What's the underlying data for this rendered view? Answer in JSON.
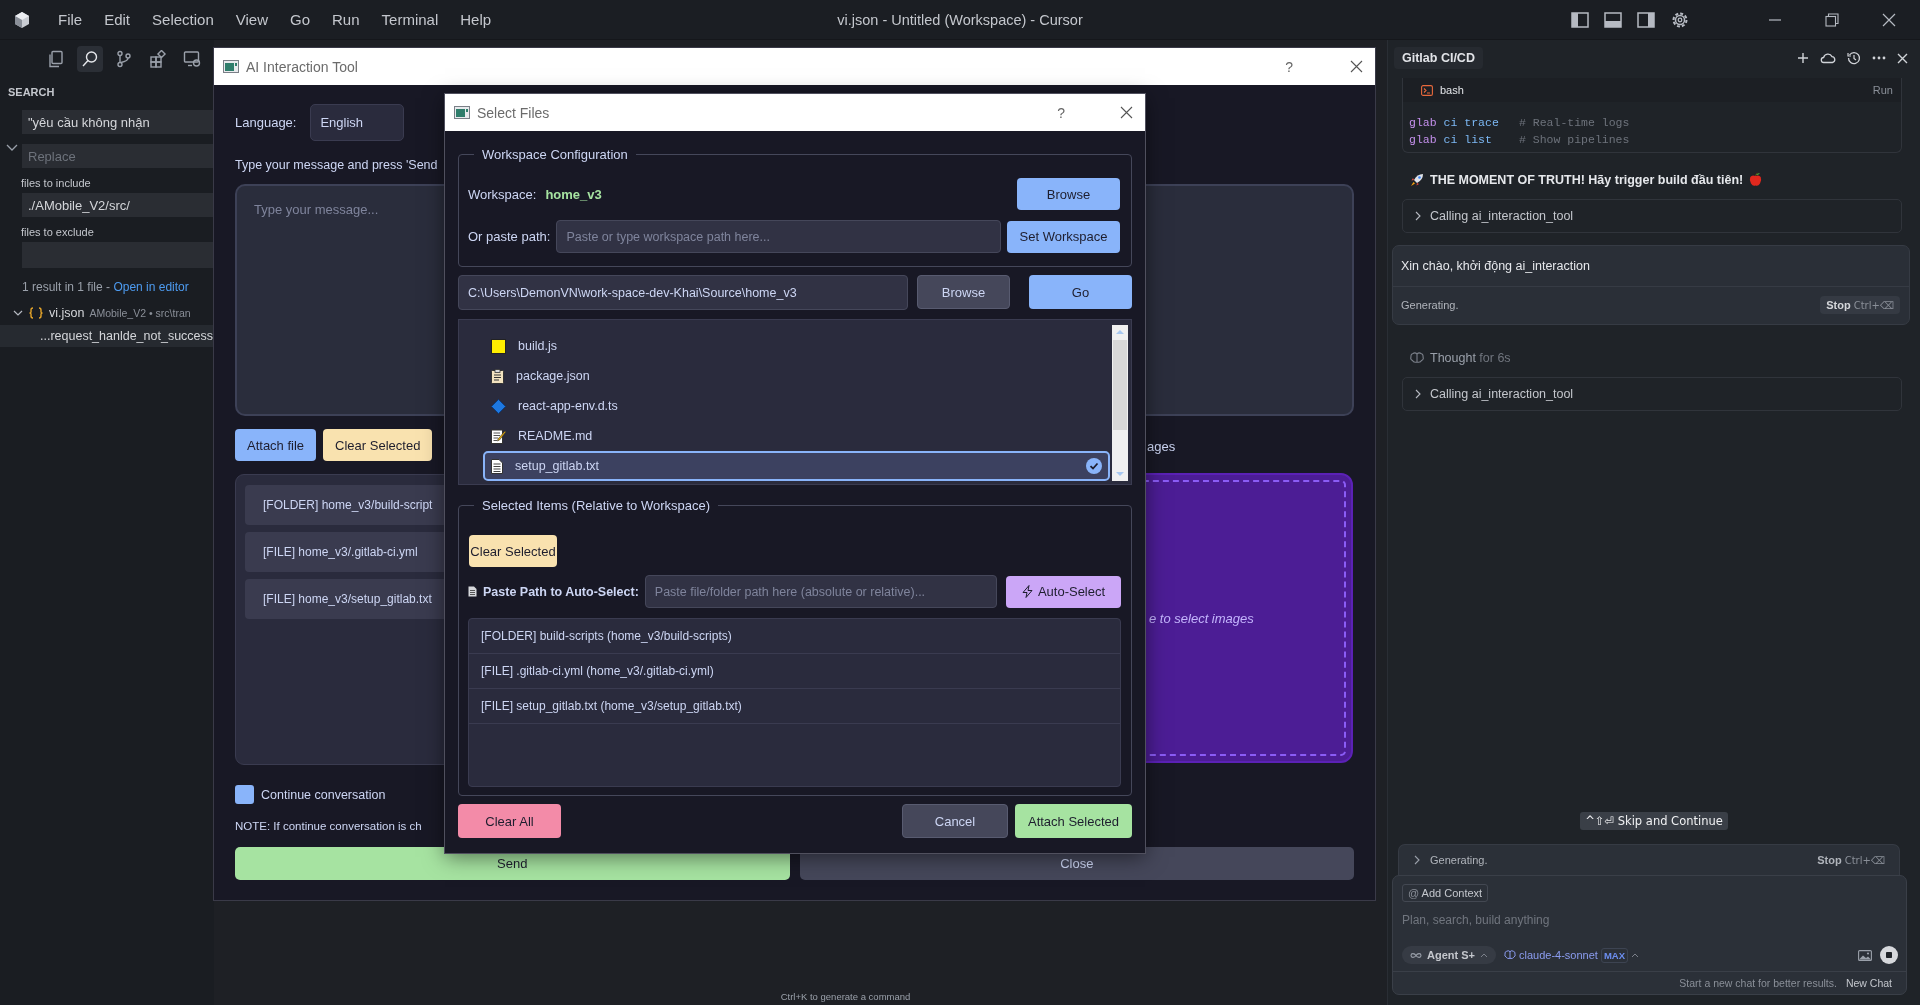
{
  "window": {
    "title": "vi.json - Untitled (Workspace) - Cursor"
  },
  "menu": [
    "File",
    "Edit",
    "Selection",
    "View",
    "Go",
    "Run",
    "Terminal",
    "Help"
  ],
  "activity": [
    {
      "kind": "explorer",
      "selected": false
    },
    {
      "kind": "search",
      "selected": true
    },
    {
      "kind": "source-control",
      "selected": false
    },
    {
      "kind": "extensions",
      "selected": false
    },
    {
      "kind": "remote",
      "selected": false
    }
  ],
  "sidebar": {
    "title": "SEARCH",
    "search": {
      "value": "\"yêu cầu không nhận"
    },
    "replace": {
      "placeholder": "Replace"
    },
    "include_label": "files to include",
    "include": {
      "value": "./AMobile_V2/src/"
    },
    "exclude_label": "files to exclude",
    "summary": "1 result in 1 file - ",
    "open_link": "Open in editor",
    "results": [
      {
        "file": "vi.json",
        "folder": "AMobile_V2 • src\\tran",
        "expanded": true,
        "children": [
          {
            "text": "...request_hanlde_not_success"
          }
        ]
      }
    ]
  },
  "ai_tool": {
    "title": "AI Interaction Tool",
    "help": "?",
    "language_label": "Language:",
    "language": "English",
    "prompt": "Type your message and press 'Send",
    "message": {
      "placeholder": "Type your message..."
    },
    "buttons": [
      {
        "label": "Attach file",
        "kind": "primary"
      },
      {
        "label": "Clear Selected",
        "kind": "warning"
      }
    ],
    "attachments": [
      "[FOLDER] home_v3/build-script",
      "[FILE] home_v3/.gitlab-ci.yml",
      "[FILE] home_v3/setup_gitlab.txt"
    ],
    "images_label": "ages",
    "dropzone_hint": "e to select images",
    "continue": {
      "label": "Continue conversation",
      "checked": true
    },
    "note": "NOTE: If continue conversation is ch",
    "send": "Send",
    "close": "Close"
  },
  "dialog": {
    "title": "Select Files",
    "help": "?",
    "workspace_group": "Workspace Configuration",
    "workspace_label": "Workspace:",
    "workspace": "home_v3",
    "browse": "Browse",
    "paste_label": "Or paste path:",
    "paste": {
      "placeholder": "Paste or type workspace path here..."
    },
    "set_workspace": "Set Workspace",
    "path": {
      "value": "C:\\Users\\DemonVN\\work-space-dev-Khai\\Source\\home_v3"
    },
    "path_browse": "Browse",
    "go": "Go",
    "files": [
      {
        "name": "build.js",
        "kind": "js",
        "selected": false,
        "checked": false
      },
      {
        "name": "package.json",
        "kind": "json",
        "selected": false,
        "checked": false
      },
      {
        "name": "react-app-env.d.ts",
        "kind": "ts",
        "selected": false,
        "checked": false
      },
      {
        "name": "README.md",
        "kind": "md",
        "selected": false,
        "checked": false
      },
      {
        "name": "setup_gitlab.txt",
        "kind": "text",
        "selected": true,
        "checked": true
      }
    ],
    "selected_group": "Selected Items (Relative to Workspace)",
    "clear_selected": "Clear Selected",
    "autoselect_label": "Paste Path to Auto-Select:",
    "autoselect": {
      "placeholder": "Paste file/folder path here (absolute or relative)..."
    },
    "autoselect_button": "Auto-Select",
    "selected_items": [
      "[FOLDER] build-scripts (home_v3/build-scripts)",
      "[FILE] .gitlab-ci.yml (home_v3/.gitlab-ci.yml)",
      "[FILE] setup_gitlab.txt (home_v3/setup_gitlab.txt)"
    ],
    "clear_all": "Clear All",
    "cancel": "Cancel",
    "attach": "Attach Selected"
  },
  "chat": {
    "tab": "Gitlab CI/CD",
    "code": {
      "lang": "bash",
      "run": "Run",
      "lines": [
        {
          "program": "glab",
          "args": "ci trace",
          "comment": "# Real-time logs"
        },
        {
          "program": "glab",
          "args": "ci list",
          "comment": "# Show pipelines"
        }
      ]
    },
    "headline": "THE MOMENT OF TRUTH! Hãy trigger build đầu tiên!",
    "items": [
      {
        "kind": "tool_call",
        "text": "Calling ai_interaction_tool",
        "expanded": false
      },
      {
        "kind": "message",
        "text": "Xin chào, khởi động ai_interaction",
        "status": "Generating.",
        "stop": "Stop",
        "shortcut": "Ctrl+⌫"
      },
      {
        "kind": "thought",
        "text": "Thought",
        "duration": "for 6s"
      },
      {
        "kind": "tool_call",
        "text": "Calling ai_interaction_tool",
        "expanded": false
      }
    ],
    "skip": "^⇧⏎ Skip and Continue",
    "generating": {
      "text": "Generating.",
      "stop": "Stop",
      "shortcut": "Ctrl+⌫",
      "expanded": false
    },
    "composer": {
      "context_prefix": "@",
      "add_context": "Add Context",
      "placeholder": "Plan, search, build anything",
      "mode": "Agent S+",
      "model": "claude-4-sonnet",
      "badge": "MAX",
      "hint": "Start a new chat for better results.",
      "new_chat": "New Chat"
    }
  },
  "footer_hint": "Ctrl+K to generate a command"
}
